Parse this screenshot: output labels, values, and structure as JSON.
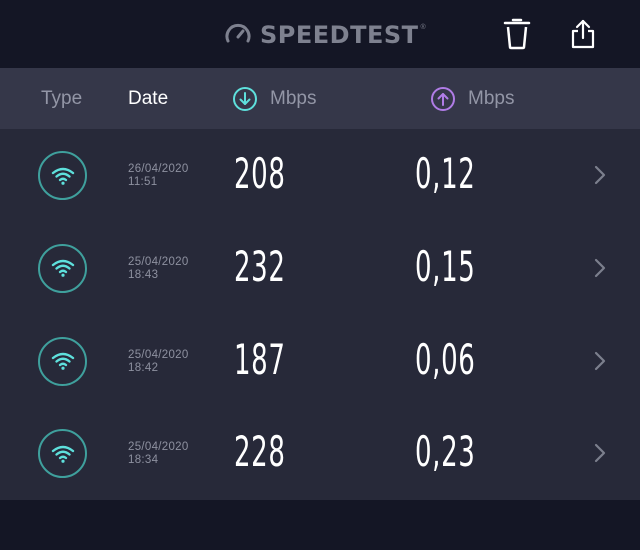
{
  "app": {
    "brand": "SPEEDTEST",
    "trademark": "®",
    "actions": {
      "delete_icon": "trash-icon",
      "share_icon": "share-icon"
    }
  },
  "colors": {
    "background": "#141625",
    "header_row": "#353749",
    "list_bg": "#272939",
    "accent_download": "#5ee0dc",
    "accent_upload": "#b07ce6",
    "wifi_ring": "#3fa09d"
  },
  "table": {
    "headers": {
      "type": "Type",
      "date": "Date",
      "download_unit": "Mbps",
      "upload_unit": "Mbps"
    },
    "rows": [
      {
        "type_icon": "wifi-icon",
        "date": "26/04/2020",
        "time": "11:51",
        "download": "208",
        "upload": "0,12"
      },
      {
        "type_icon": "wifi-icon",
        "date": "25/04/2020",
        "time": "18:43",
        "download": "232",
        "upload": "0,15"
      },
      {
        "type_icon": "wifi-icon",
        "date": "25/04/2020",
        "time": "18:42",
        "download": "187",
        "upload": "0,06"
      },
      {
        "type_icon": "wifi-icon",
        "date": "25/04/2020",
        "time": "18:34",
        "download": "228",
        "upload": "0,23"
      }
    ]
  }
}
